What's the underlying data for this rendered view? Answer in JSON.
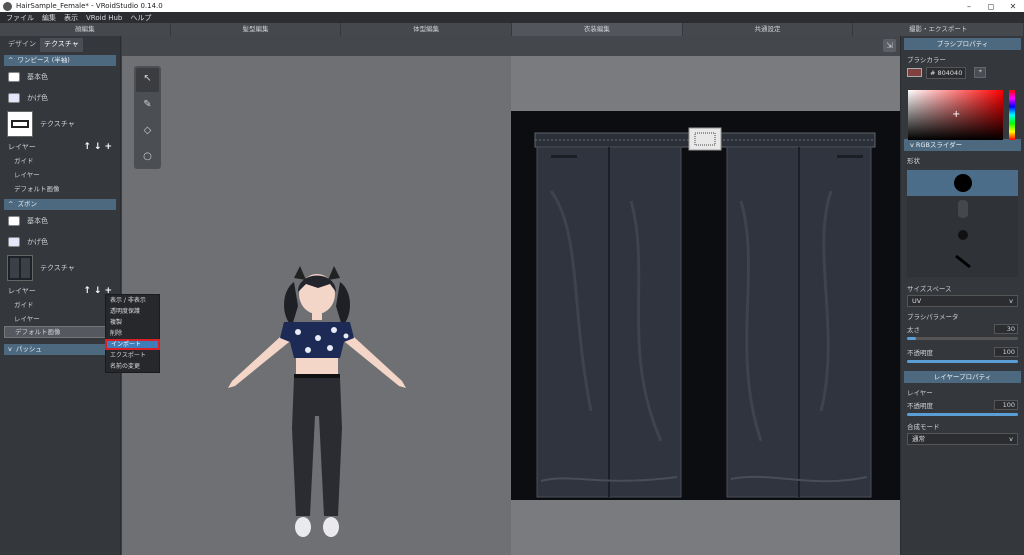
{
  "titlebar": {
    "title": "HairSample_Female* - VRoidStudio 0.14.0",
    "controls": [
      "–",
      "◻",
      "✕"
    ]
  },
  "menubar": {
    "items": [
      "ファイル",
      "編集",
      "表示",
      "VRoid Hub",
      "ヘルプ"
    ]
  },
  "mode_tabs": {
    "items": [
      "顔編集",
      "髪型編集",
      "体型編集",
      "衣装編集",
      "共通設定",
      "撮影・エクスポート"
    ],
    "active_index": 3
  },
  "left_panel": {
    "tabs": [
      "デザイン",
      "テクスチャ"
    ],
    "active_tab": 1,
    "onepiece": {
      "header": "ワンピース (半袖)",
      "base_color": "基本色",
      "shadow_color": "かげ色",
      "texture": "テクスチャ",
      "layer_label": "レイヤー",
      "layers": [
        "ガイド",
        "レイヤー",
        "デフォルト画像"
      ]
    },
    "pants": {
      "header": "ズボン",
      "base_color": "基本色",
      "shadow_color": "かげ色",
      "texture": "テクスチャ",
      "layer_label": "レイヤー",
      "layers": [
        "ガイド",
        "レイヤー",
        "デフォルト画像"
      ]
    },
    "patch": {
      "header": "パッシュ"
    }
  },
  "context_menu": {
    "items": [
      "表示 / 非表示",
      "透明度保護",
      "複製",
      "削除",
      "インポート",
      "エクスポート",
      "名前の変更"
    ],
    "highlighted_index": 4
  },
  "tools": [
    "select-tool",
    "pen-tool",
    "eraser-tool",
    "fill-tool"
  ],
  "right_panel": {
    "brush_header": "ブラシプロパティ",
    "brush_color_label": "ブラシカラー",
    "hex_value": "# 804040",
    "color": "#804040",
    "rgb_slider": "RGBスライダー",
    "shape_label": "形状",
    "size_space_label": "サイズスペース",
    "size_space_value": "UV",
    "brush_params_label": "ブラシパラメータ",
    "thickness_label": "太さ",
    "thickness_value": "30",
    "opacity_label": "不透明度",
    "opacity_value": "100",
    "layer_header": "レイヤープロパティ",
    "layer_label": "レイヤー",
    "layer_opacity_label": "不透明度",
    "layer_opacity_value": "100",
    "blend_label": "合成モード",
    "blend_value": "通常"
  }
}
